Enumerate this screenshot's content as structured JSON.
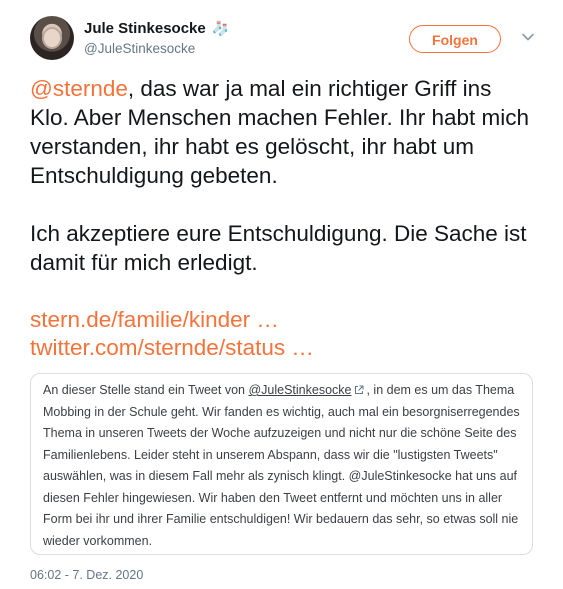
{
  "user": {
    "display_name": "Jule Stinkesocke",
    "handle": "@JuleStinkesocke",
    "name_icon": "socks-icon"
  },
  "actions": {
    "follow_label": "Folgen",
    "menu_icon": "chevron-down-icon"
  },
  "tweet": {
    "mention": "@sternde",
    "line1_rest": ", das war ja mal ein richtiger Griff ins Klo. Aber Menschen machen Fehler. Ihr habt mich verstanden, ihr habt es gelöscht, ihr habt um Entschuldigung gebeten.",
    "paragraph2": "Ich akzeptiere eure Entschuldigung. Die Sache ist damit für mich erledigt.",
    "link1": "stern.de/familie/kinder …",
    "link2": "twitter.com/sternde/status …"
  },
  "quote": {
    "text_before": "An dieser Stelle stand ein Tweet von ",
    "handle": "@JuleStinkesocke",
    "text_after": ", in dem es um das Thema Mobbing in der Schule geht. Wir fanden es wichtig, auch mal ein besorgniserregendes Thema in unseren Tweets der Woche aufzuzeigen und nicht nur die schöne Seite des Familienlebens. Leider steht in unserem Abspann, dass wir die \"lustigsten Tweets\" auswählen, was in diesem Fall mehr als zynisch klingt. @JuleStinkesocke hat uns auf diesen Fehler hingewiesen. Wir haben den Tweet entfernt und möchten uns in aller Form bei ihr und ihrer Familie entschuldigen! Wir bedauern das sehr, so etwas soll nie wieder vorkommen."
  },
  "timestamp": "06:02 - 7. Dez. 2020",
  "colors": {
    "accent": "#f4733b",
    "text": "#14171a",
    "secondary": "#657786",
    "border": "#d8dee3"
  }
}
